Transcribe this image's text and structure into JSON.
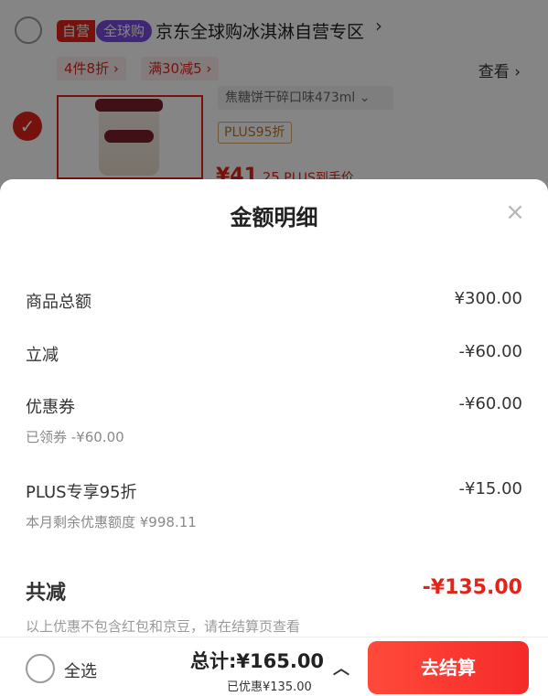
{
  "cart": {
    "store": {
      "tag_self": "自营",
      "tag_global": "全球购",
      "name": "京东全球购冰淇淋自营专区",
      "chevron": "›"
    },
    "promos": [
      "4件8折 ›",
      "满30减5 ›"
    ],
    "see_more": "查看 ›",
    "item": {
      "checked_mark": "✓",
      "sku_text": "焦糖饼干碎口味473ml  ⌄",
      "plus_tag": "PLUS95折",
      "price_main": "¥41",
      "price_dec": ".25",
      "price_plus": " PLUS到手价"
    }
  },
  "sheet": {
    "title": "金额明细",
    "close": "×",
    "rows": [
      {
        "label": "商品总额",
        "amount": "¥300.00"
      },
      {
        "label": "立减",
        "amount": "-¥60.00"
      },
      {
        "label": "优惠券",
        "amount": "-¥60.00",
        "sub": "已领券 -¥60.00"
      },
      {
        "label": "PLUS专享95折",
        "amount": "-¥15.00",
        "sub": "本月剩余优惠额度 ¥998.11"
      }
    ],
    "total_label": "共减",
    "total_amount": "-¥135.00",
    "note": "以上优惠不包含红包和京豆，请在结算页查看"
  },
  "bottom": {
    "select_all": "全选",
    "total": "总计:¥165.00",
    "saved": "已优惠¥135.00",
    "chevron": "︿",
    "checkout": "去结算"
  },
  "colors": {
    "accent_red": "#e2231a",
    "global_purple": "#7b4be0"
  }
}
